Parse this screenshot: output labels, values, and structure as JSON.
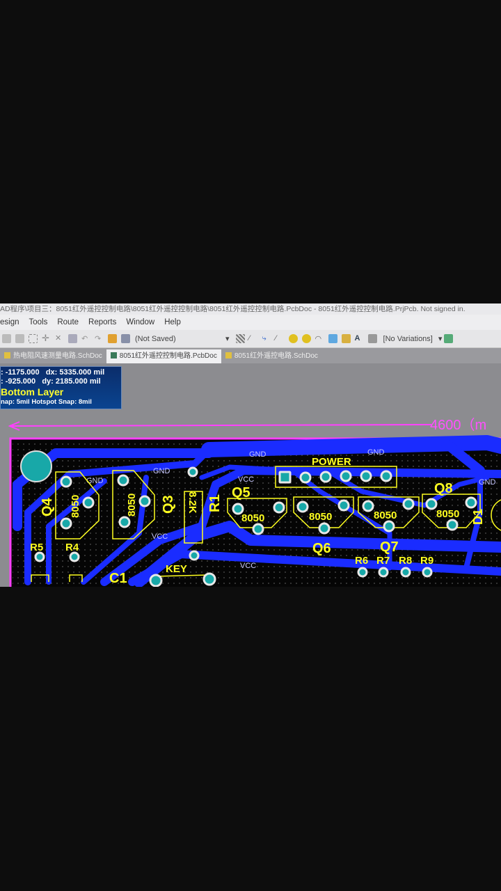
{
  "window": {
    "title": "AD程序\\项目三：8051红外遥控控制电路\\8051红外遥控控制电路\\8051红外遥控控制电路.PcbDoc - 8051红外遥控控制电路.PrjPcb. Not signed in."
  },
  "menu": [
    "esign",
    "Tools",
    "Route",
    "Reports",
    "Window",
    "Help"
  ],
  "toolbar": {
    "saved_state": "(Not Saved)",
    "variations": "[No Variations]"
  },
  "tabs": [
    {
      "label": "热电阻风速测量电路.SchDoc",
      "active": false
    },
    {
      "label": "8051红外遥控控制电路.PcbDoc",
      "active": true
    },
    {
      "label": "8051红外遥控电路.SchDoc",
      "active": false
    }
  ],
  "hud": {
    "x": ": -1175.000",
    "dx": "dx:  5335.000 mil",
    "y": ":  -925.000",
    "dy": "dy:  2185.000 mil",
    "layer": "Bottom Layer",
    "snap": "nap: 5mil Hotspot Snap: 8mil"
  },
  "dimension": {
    "label": "4600（m"
  },
  "pcb": {
    "colors": {
      "board": "#050505",
      "trace": "#1a2cff",
      "silk": "#ffff20",
      "pad": "#18a8a8",
      "outline": "#ff40ff"
    },
    "components": {
      "q4": "Q4",
      "q3": "Q3",
      "q5": "Q5",
      "q6": "Q6",
      "q7": "Q7",
      "q8": "Q8",
      "r1": "R1",
      "r4": "R4",
      "r5": "R5",
      "r6": "R6",
      "r7": "R7",
      "r8": "R8",
      "r9": "R9",
      "c1": "C1",
      "key": "KEY",
      "power": "POWER",
      "d1": "D1",
      "part": "8050",
      "r1val": "8.2K"
    },
    "nets": {
      "gnd": "GND",
      "vcc": "VCC"
    }
  }
}
